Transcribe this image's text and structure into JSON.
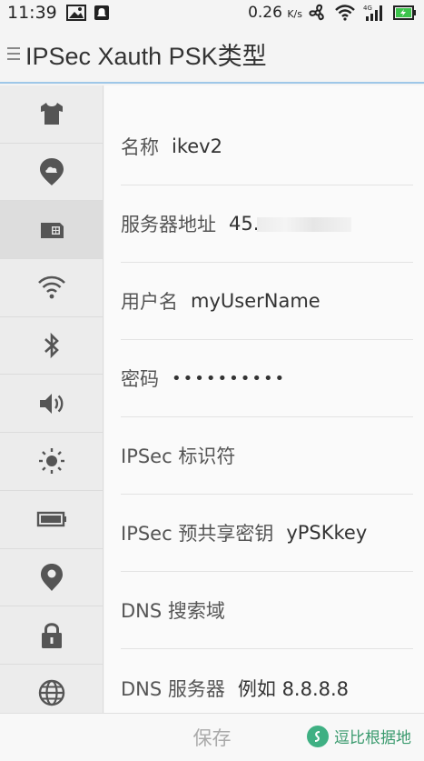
{
  "statusbar": {
    "time": "11:39",
    "speed": "0.26",
    "speed_unit": "K/s"
  },
  "header": {
    "title": "IPSec Xauth PSK类型"
  },
  "sidebar": {
    "items": [
      {
        "icon": "theme-shirt-icon"
      },
      {
        "icon": "cloud-pin-icon"
      },
      {
        "icon": "sim-card-icon",
        "active": true
      },
      {
        "icon": "wifi-icon"
      },
      {
        "icon": "bluetooth-icon"
      },
      {
        "icon": "volume-icon"
      },
      {
        "icon": "brightness-icon"
      },
      {
        "icon": "battery-icon"
      },
      {
        "icon": "location-icon"
      },
      {
        "icon": "lock-icon"
      },
      {
        "icon": "globe-icon"
      }
    ]
  },
  "form": {
    "name_label": "名称",
    "name_value": "ikev2",
    "server_label": "服务器地址",
    "server_value": "45.",
    "username_label": "用户名",
    "username_value": "myUserName",
    "password_label": "密码",
    "password_value": "••••••••••",
    "ipsec_id_label": "IPSec 标识符",
    "psk_label": "IPSec 预共享密钥",
    "psk_value": "yPSKkey",
    "dns_search_label": "DNS 搜索域",
    "dns_server_label": "DNS 服务器",
    "dns_server_placeholder": "例如 8.8.8.8"
  },
  "bottombar": {
    "save_label": "保存",
    "watermark": "逗比根据地"
  },
  "colors": {
    "accent_line": "#9ec7e8",
    "battery_green": "#3cc44b",
    "watermark_green": "#3fb083"
  }
}
